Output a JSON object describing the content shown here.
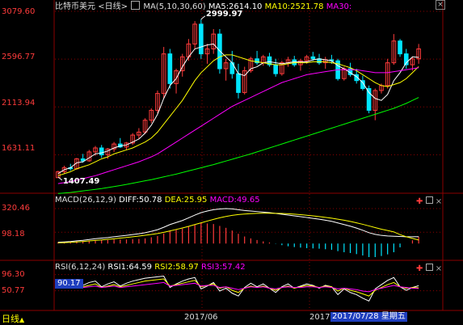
{
  "header": {
    "title": "比特币美元",
    "period": "<日线>",
    "ma_label": "MA(5,10,30,60)",
    "ma5": "MA5:2614.10",
    "ma10": "MA10:2521.78",
    "ma30": "MA30:"
  },
  "macd_header": {
    "label": "MACD(26,12,9)",
    "diff": "DIFF:50.78",
    "dea": "DEA:25.95",
    "macd": "MACD:49.65"
  },
  "rsi_header": {
    "label": "RSI(6,12,24)",
    "rsi1": "RSI1:64.59",
    "rsi2": "RSI2:58.97",
    "rsi3": "RSI3:57.42"
  },
  "footer": {
    "period_tab": "日线",
    "date_mid": "2017/06",
    "year_label": "2017",
    "cursor_date": "2017/07/28",
    "weekday": "星期五"
  },
  "price_axis": [
    "3079.60",
    "2596.77",
    "2113.94",
    "1631.11"
  ],
  "macd_axis": [
    "320.46",
    "98.18"
  ],
  "rsi_axis": [
    "96.30",
    "50.77"
  ],
  "rsi_cursor_value": "90.17",
  "colors": {
    "up": "#ff3b3b",
    "down": "#00e5ff",
    "ma5": "#ffffff",
    "ma10": "#ffff00",
    "ma30": "#ff00ff",
    "ma60": "#00ff00",
    "grid": "#8b0000",
    "axis_text": "#ff3b3b"
  },
  "chart_data": [
    {
      "type": "candlestick",
      "title": "比特币美元 <日线>",
      "ylim": [
        1300,
        3079.6
      ],
      "y_ticks": [
        3079.6,
        2596.77,
        2113.94,
        1631.11
      ],
      "annotations": [
        {
          "text": "2999.97",
          "kind": "high"
        },
        {
          "text": "1407.49",
          "kind": "low"
        }
      ],
      "ohlc": [
        [
          1400,
          1470,
          1407,
          1460
        ],
        [
          1460,
          1520,
          1440,
          1500
        ],
        [
          1500,
          1540,
          1470,
          1490
        ],
        [
          1490,
          1600,
          1480,
          1590
        ],
        [
          1590,
          1640,
          1550,
          1570
        ],
        [
          1570,
          1680,
          1560,
          1660
        ],
        [
          1660,
          1720,
          1620,
          1700
        ],
        [
          1700,
          1730,
          1600,
          1630
        ],
        [
          1630,
          1700,
          1590,
          1690
        ],
        [
          1690,
          1760,
          1660,
          1740
        ],
        [
          1740,
          1800,
          1700,
          1710
        ],
        [
          1710,
          1760,
          1680,
          1750
        ],
        [
          1750,
          1850,
          1730,
          1830
        ],
        [
          1830,
          1900,
          1790,
          1860
        ],
        [
          1860,
          2000,
          1840,
          1980
        ],
        [
          1980,
          2100,
          1950,
          2080
        ],
        [
          2080,
          2280,
          2050,
          2250
        ],
        [
          2250,
          2720,
          2200,
          2650
        ],
        [
          2650,
          2700,
          2300,
          2350
        ],
        [
          2350,
          2500,
          2250,
          2480
        ],
        [
          2480,
          2650,
          2420,
          2620
        ],
        [
          2620,
          2800,
          2580,
          2750
        ],
        [
          2750,
          2980,
          2700,
          2950
        ],
        [
          2950,
          2999.97,
          2600,
          2650
        ],
        [
          2650,
          2750,
          2550,
          2700
        ],
        [
          2700,
          2900,
          2650,
          2850
        ],
        [
          2850,
          2900,
          2450,
          2500
        ],
        [
          2500,
          2600,
          2380,
          2560
        ],
        [
          2560,
          2680,
          2400,
          2450
        ],
        [
          2450,
          2550,
          2200,
          2260
        ],
        [
          2260,
          2520,
          2240,
          2480
        ],
        [
          2480,
          2620,
          2460,
          2600
        ],
        [
          2600,
          2680,
          2540,
          2560
        ],
        [
          2560,
          2640,
          2530,
          2620
        ],
        [
          2620,
          2660,
          2520,
          2540
        ],
        [
          2540,
          2600,
          2420,
          2450
        ],
        [
          2450,
          2580,
          2430,
          2560
        ],
        [
          2560,
          2620,
          2520,
          2590
        ],
        [
          2590,
          2630,
          2520,
          2540
        ],
        [
          2540,
          2600,
          2480,
          2580
        ],
        [
          2580,
          2640,
          2550,
          2620
        ],
        [
          2620,
          2670,
          2580,
          2600
        ],
        [
          2600,
          2650,
          2540,
          2560
        ],
        [
          2560,
          2620,
          2500,
          2590
        ],
        [
          2590,
          2640,
          2550,
          2580
        ],
        [
          2580,
          2600,
          2380,
          2400
        ],
        [
          2400,
          2520,
          2380,
          2500
        ],
        [
          2500,
          2560,
          2420,
          2440
        ],
        [
          2440,
          2500,
          2350,
          2380
        ],
        [
          2380,
          2430,
          2280,
          2300
        ],
        [
          2300,
          2330,
          2050,
          2080
        ],
        [
          2080,
          2300,
          1980,
          2280
        ],
        [
          2280,
          2350,
          2250,
          2330
        ],
        [
          2330,
          2600,
          2300,
          2560
        ],
        [
          2560,
          2850,
          2540,
          2780
        ],
        [
          2780,
          2800,
          2620,
          2650
        ],
        [
          2650,
          2700,
          2500,
          2540
        ],
        [
          2540,
          2620,
          2480,
          2600
        ],
        [
          2600,
          2750,
          2550,
          2700
        ]
      ],
      "ma_series": [
        {
          "name": "MA5",
          "values": [
            1440,
            1480,
            1500,
            1550,
            1560,
            1600,
            1640,
            1650,
            1670,
            1700,
            1720,
            1730,
            1760,
            1790,
            1850,
            1930,
            2040,
            2200,
            2330,
            2400,
            2520,
            2620,
            2700,
            2720,
            2740,
            2750,
            2680,
            2620,
            2560,
            2450,
            2430,
            2500,
            2520,
            2560,
            2570,
            2560,
            2550,
            2560,
            2570,
            2570,
            2570,
            2590,
            2600,
            2590,
            2580,
            2530,
            2500,
            2460,
            2420,
            2360,
            2260,
            2200,
            2180,
            2240,
            2380,
            2460,
            2560,
            2620,
            2614
          ]
        },
        {
          "name": "MA10",
          "values": [
            1420,
            1440,
            1460,
            1490,
            1510,
            1530,
            1560,
            1590,
            1610,
            1640,
            1660,
            1680,
            1700,
            1730,
            1760,
            1800,
            1860,
            1940,
            2020,
            2100,
            2180,
            2280,
            2380,
            2460,
            2520,
            2580,
            2620,
            2640,
            2640,
            2620,
            2600,
            2580,
            2570,
            2560,
            2550,
            2540,
            2540,
            2550,
            2560,
            2560,
            2560,
            2570,
            2570,
            2570,
            2560,
            2550,
            2530,
            2510,
            2480,
            2440,
            2400,
            2360,
            2330,
            2320,
            2340,
            2360,
            2400,
            2460,
            2522
          ]
        },
        {
          "name": "MA30",
          "values": [
            1340,
            1350,
            1360,
            1375,
            1390,
            1405,
            1420,
            1440,
            1460,
            1480,
            1500,
            1520,
            1540,
            1560,
            1585,
            1610,
            1640,
            1680,
            1720,
            1760,
            1800,
            1840,
            1880,
            1920,
            1960,
            2000,
            2040,
            2080,
            2120,
            2150,
            2180,
            2210,
            2240,
            2270,
            2300,
            2330,
            2360,
            2380,
            2400,
            2420,
            2440,
            2450,
            2460,
            2470,
            2480,
            2490,
            2490,
            2490,
            2490,
            2480,
            2470,
            2460,
            2460,
            2460,
            2470,
            2480,
            2490,
            2500,
            2510
          ]
        },
        {
          "name": "MA60",
          "values": [
            1240,
            1245,
            1250,
            1258,
            1266,
            1274,
            1282,
            1290,
            1300,
            1310,
            1320,
            1332,
            1344,
            1356,
            1368,
            1380,
            1394,
            1408,
            1422,
            1436,
            1452,
            1468,
            1484,
            1500,
            1516,
            1532,
            1550,
            1568,
            1586,
            1604,
            1622,
            1640,
            1660,
            1680,
            1700,
            1720,
            1740,
            1760,
            1780,
            1800,
            1820,
            1840,
            1860,
            1880,
            1900,
            1920,
            1940,
            1960,
            1980,
            2000,
            2020,
            2040,
            2060,
            2080,
            2100,
            2125,
            2150,
            2180,
            2210
          ]
        }
      ]
    },
    {
      "type": "line",
      "title": "MACD(26,12,9)",
      "y_ticks": [
        320.46,
        98.18
      ],
      "series": [
        {
          "name": "DIFF",
          "values": [
            10,
            12,
            15,
            20,
            24,
            30,
            36,
            40,
            44,
            50,
            55,
            60,
            66,
            72,
            80,
            90,
            102,
            120,
            140,
            155,
            170,
            190,
            210,
            228,
            240,
            250,
            255,
            258,
            256,
            250,
            244,
            240,
            236,
            232,
            228,
            222,
            216,
            210,
            204,
            198,
            192,
            186,
            180,
            172,
            164,
            152,
            140,
            128,
            114,
            98,
            80,
            68,
            60,
            56,
            54,
            52,
            50,
            50,
            51
          ]
        },
        {
          "name": "DEA",
          "values": [
            5,
            7,
            9,
            12,
            15,
            19,
            23,
            27,
            31,
            35,
            40,
            45,
            50,
            55,
            61,
            67,
            74,
            83,
            93,
            104,
            115,
            127,
            140,
            153,
            166,
            178,
            190,
            200,
            208,
            214,
            218,
            221,
            223,
            224,
            224,
            223,
            222,
            220,
            217,
            213,
            209,
            204,
            199,
            193,
            187,
            180,
            172,
            163,
            153,
            142,
            130,
            118,
            106,
            96,
            86,
            66,
            50,
            38,
            26
          ]
        },
        {
          "name": "MACD",
          "values": [
            10,
            10,
            12,
            16,
            18,
            22,
            26,
            26,
            26,
            30,
            30,
            30,
            32,
            34,
            38,
            46,
            56,
            74,
            94,
            102,
            110,
            126,
            140,
            150,
            148,
            144,
            130,
            116,
            96,
            72,
            52,
            38,
            26,
            16,
            8,
            -2,
            -12,
            -20,
            -26,
            -30,
            -34,
            -36,
            -38,
            -42,
            -46,
            -56,
            -64,
            -70,
            -78,
            -88,
            -100,
            -100,
            -92,
            -80,
            -64,
            -28,
            0,
            24,
            49.65
          ]
        }
      ]
    },
    {
      "type": "line",
      "title": "RSI(6,12,24)",
      "y_ticks": [
        96.3,
        50.77
      ],
      "series": [
        {
          "name": "RSI1",
          "values": [
            70,
            74,
            72,
            80,
            66,
            74,
            78,
            62,
            70,
            76,
            64,
            72,
            78,
            82,
            86,
            88,
            90,
            92,
            60,
            70,
            78,
            84,
            88,
            56,
            64,
            74,
            50,
            58,
            44,
            36,
            60,
            72,
            62,
            70,
            58,
            46,
            62,
            70,
            58,
            64,
            70,
            66,
            58,
            66,
            62,
            40,
            56,
            46,
            40,
            30,
            22,
            56,
            68,
            80,
            88,
            62,
            52,
            60,
            65
          ]
        },
        {
          "name": "RSI2",
          "values": [
            62,
            65,
            64,
            70,
            62,
            66,
            70,
            60,
            64,
            68,
            62,
            66,
            70,
            74,
            78,
            80,
            82,
            84,
            64,
            68,
            72,
            76,
            80,
            62,
            66,
            70,
            58,
            62,
            52,
            46,
            58,
            64,
            60,
            64,
            58,
            52,
            60,
            64,
            58,
            62,
            66,
            64,
            60,
            64,
            62,
            50,
            58,
            52,
            48,
            42,
            36,
            52,
            60,
            68,
            74,
            62,
            58,
            60,
            59
          ]
        },
        {
          "name": "RSI3",
          "values": [
            58,
            60,
            60,
            64,
            60,
            62,
            64,
            60,
            62,
            64,
            60,
            62,
            64,
            66,
            68,
            70,
            72,
            74,
            64,
            66,
            68,
            70,
            72,
            64,
            66,
            66,
            60,
            62,
            58,
            54,
            58,
            62,
            60,
            62,
            58,
            56,
            60,
            62,
            60,
            60,
            62,
            62,
            60,
            62,
            60,
            56,
            58,
            56,
            54,
            50,
            48,
            54,
            58,
            62,
            66,
            62,
            60,
            58,
            57
          ]
        }
      ]
    }
  ]
}
